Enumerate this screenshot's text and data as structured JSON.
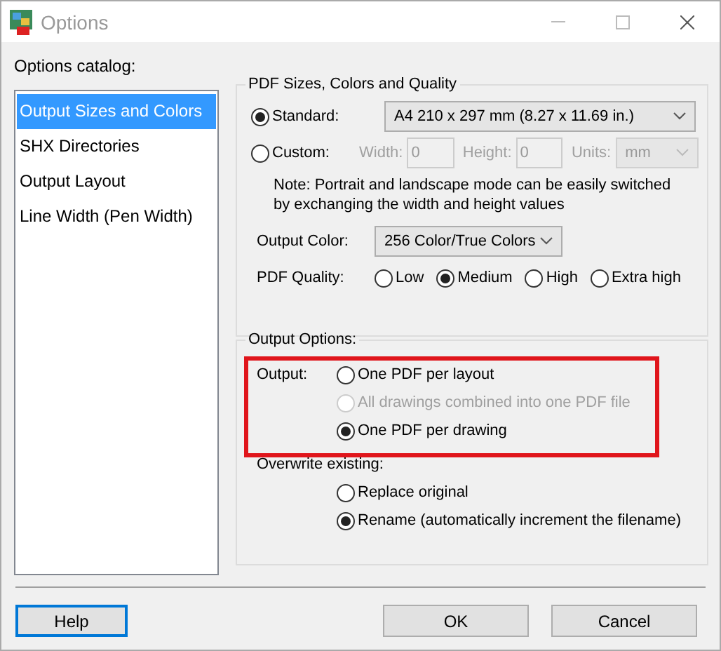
{
  "window": {
    "title": "Options"
  },
  "catalog": {
    "label": "Options catalog:",
    "items": [
      {
        "label": "Output Sizes and Colors",
        "selected": true
      },
      {
        "label": "SHX Directories",
        "selected": false
      },
      {
        "label": "Output Layout",
        "selected": false
      },
      {
        "label": "Line Width (Pen Width)",
        "selected": false
      }
    ]
  },
  "pdf_group": {
    "title": "PDF Sizes, Colors and Quality",
    "standard": {
      "label": "Standard:",
      "selected": true,
      "value": "A4 210 x 297 mm (8.27 x 11.69 in.)"
    },
    "custom": {
      "label": "Custom:",
      "selected": false,
      "disabled": true,
      "width_label": "Width:",
      "width_value": "0",
      "height_label": "Height:",
      "height_value": "0",
      "units_label": "Units:",
      "units_value": "mm"
    },
    "note_lines": [
      "Note: Portrait and landscape mode can be easily switched",
      "by exchanging the width and height values"
    ],
    "output_color": {
      "label": "Output Color:",
      "value": "256 Color/True Colors"
    },
    "quality": {
      "label": "PDF Quality:",
      "options": [
        {
          "label": "Low",
          "selected": false
        },
        {
          "label": "Medium",
          "selected": true
        },
        {
          "label": "High",
          "selected": false
        },
        {
          "label": "Extra high",
          "selected": false
        }
      ]
    }
  },
  "output_group": {
    "title": "Output Options:",
    "highlighted": true,
    "output": {
      "label": "Output:",
      "options": [
        {
          "label": "One PDF per layout",
          "selected": false,
          "disabled": false
        },
        {
          "label": "All drawings combined into one PDF file",
          "selected": false,
          "disabled": true
        },
        {
          "label": "One PDF per drawing",
          "selected": true,
          "disabled": false
        }
      ]
    },
    "overwrite": {
      "label": "Overwrite existing:",
      "options": [
        {
          "label": "Replace original",
          "selected": false,
          "disabled": false
        },
        {
          "label": "Rename (automatically increment the filename)",
          "selected": true,
          "disabled": false
        }
      ]
    }
  },
  "buttons": [
    {
      "label": "Help",
      "focused": true
    },
    {
      "label": "OK",
      "focused": false
    },
    {
      "label": "Cancel",
      "focused": false
    }
  ]
}
